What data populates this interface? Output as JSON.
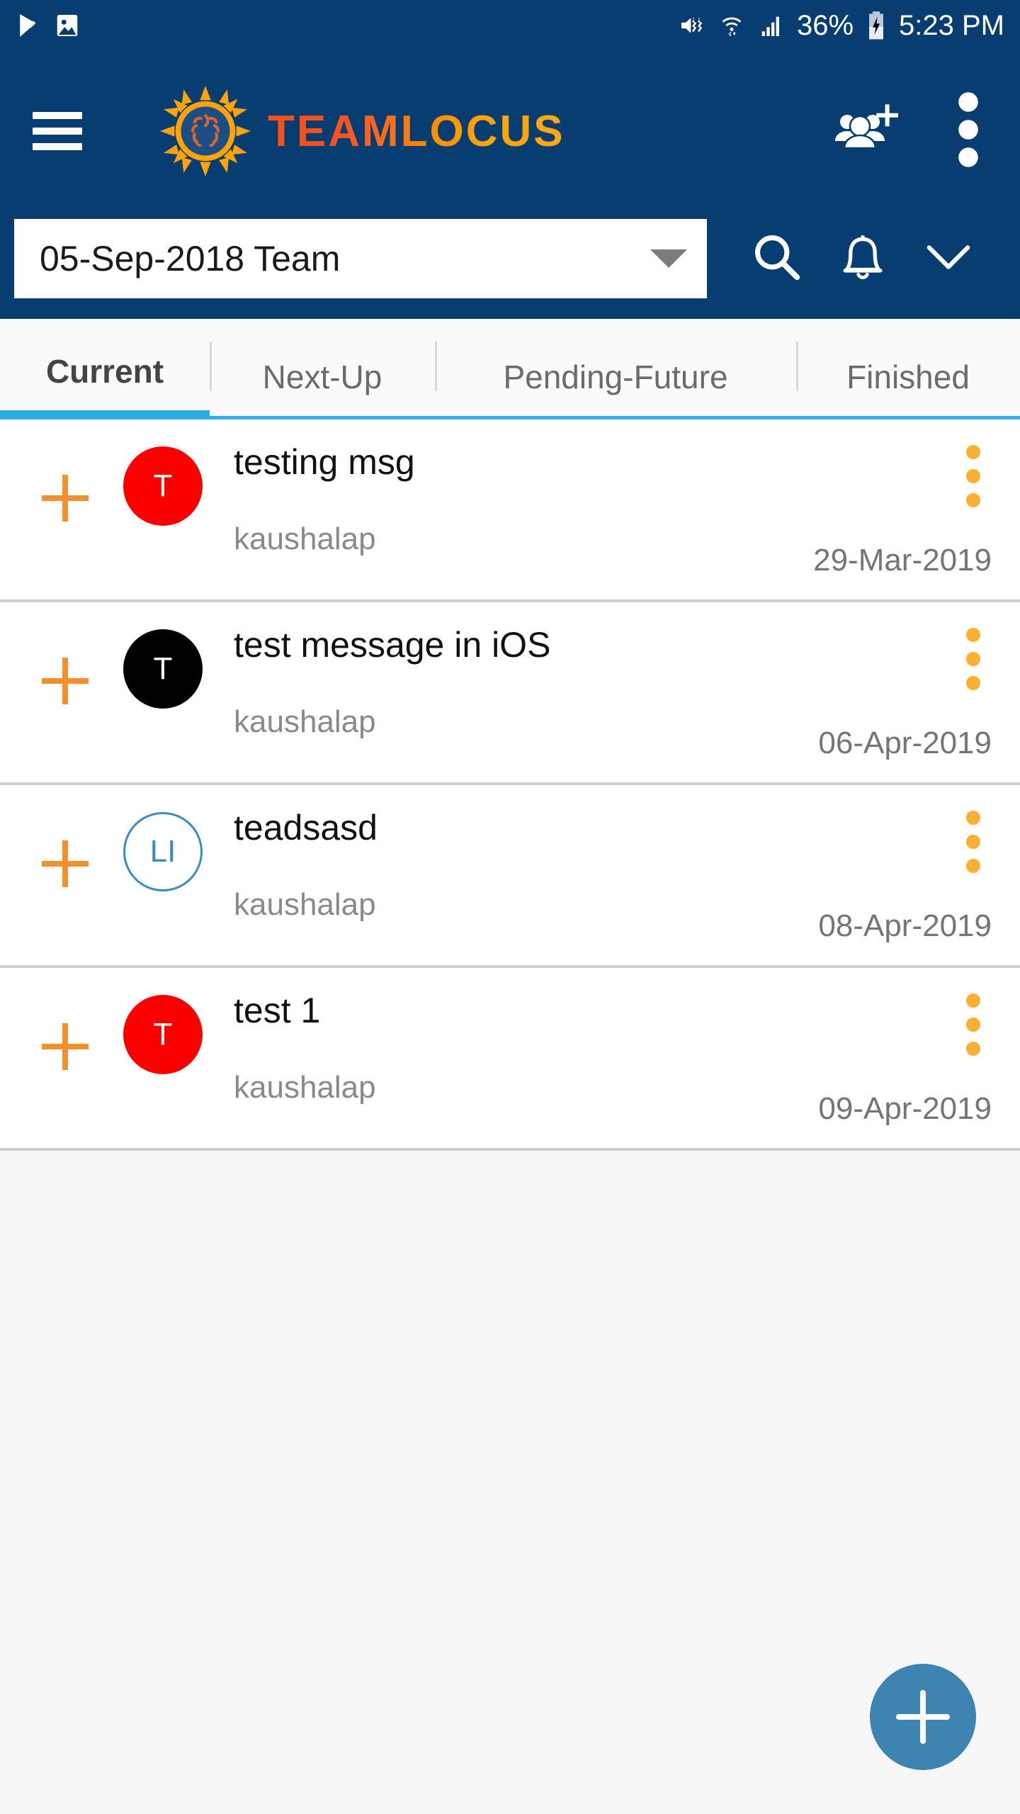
{
  "status_bar": {
    "left_icons": [
      "play-check-icon",
      "image-icon"
    ],
    "right_icons": [
      "mute-vibrate-icon",
      "wifi-icon",
      "signal-icon",
      "battery-charging-icon"
    ],
    "battery_percent": "36%",
    "time": "5:23 PM"
  },
  "app_bar": {
    "menu_icon": "hamburger-menu-icon",
    "logo_icon": "sun-logo-icon",
    "brand": "TEAMLOCUS",
    "add_group_icon": "add-group-icon",
    "overflow_icon": "more-vertical-icon",
    "background": "#083D72"
  },
  "team_bar": {
    "selected_team": "05-Sep-2018 Team",
    "dropdown_icon": "caret-down-icon",
    "search_icon": "search-icon",
    "notification_icon": "bell-icon",
    "expand_icon": "chevron-down-icon"
  },
  "tabs": [
    {
      "label": "Current",
      "active": true
    },
    {
      "label": "Next-Up",
      "active": false
    },
    {
      "label": "Pending-Future",
      "active": false
    },
    {
      "label": "Finished",
      "active": false
    }
  ],
  "tab_accent_color": "#29ADE3",
  "list": {
    "rows": [
      {
        "add_icon": "plus-icon",
        "avatar_initials": "T",
        "avatar_bg": "#FA0000",
        "avatar_fg": "#ffffff",
        "avatar_border": "none",
        "title": "testing msg",
        "author": "kaushalap",
        "date": "29-Mar-2019",
        "menu_icon": "more-vertical-icon"
      },
      {
        "add_icon": "plus-icon",
        "avatar_initials": "T",
        "avatar_bg": "#000000",
        "avatar_fg": "#ffffff",
        "avatar_border": "none",
        "title": "test message in iOS",
        "author": "kaushalap",
        "date": "06-Apr-2019",
        "menu_icon": "more-vertical-icon"
      },
      {
        "add_icon": "plus-icon",
        "avatar_initials": "LI",
        "avatar_bg": "#ffffff",
        "avatar_fg": "#3C8DBC",
        "avatar_border": "#3C8DBC",
        "title": "teadsasd",
        "author": "kaushalap",
        "date": "08-Apr-2019",
        "menu_icon": "more-vertical-icon"
      },
      {
        "add_icon": "plus-icon",
        "avatar_initials": "T",
        "avatar_bg": "#FA0000",
        "avatar_fg": "#ffffff",
        "avatar_border": "none",
        "title": "test 1",
        "author": "kaushalap",
        "date": "09-Apr-2019",
        "menu_icon": "more-vertical-icon"
      }
    ]
  },
  "fab": {
    "icon": "plus-icon",
    "color": "#3D84B0"
  }
}
